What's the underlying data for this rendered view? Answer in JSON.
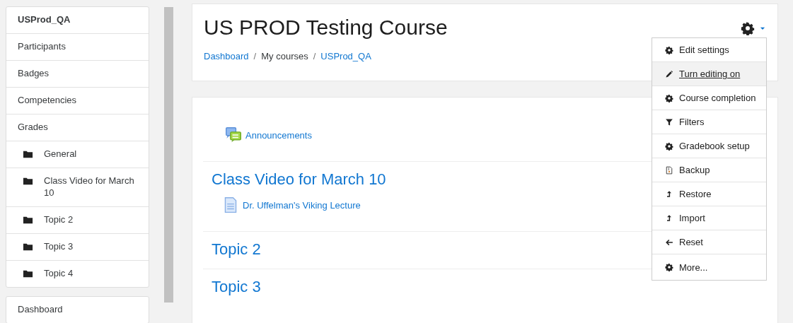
{
  "sidebar": {
    "course_block": [
      {
        "label": "USProd_QA",
        "kind": "heading"
      },
      {
        "label": "Participants",
        "kind": "link"
      },
      {
        "label": "Badges",
        "kind": "link"
      },
      {
        "label": "Competencies",
        "kind": "link"
      },
      {
        "label": "Grades",
        "kind": "link",
        "children": [
          {
            "label": "General",
            "kind": "folder"
          },
          {
            "label": "Class Video for March 10",
            "kind": "folder"
          },
          {
            "label": "Topic 2",
            "kind": "folder"
          },
          {
            "label": "Topic 3",
            "kind": "folder"
          },
          {
            "label": "Topic 4",
            "kind": "folder"
          }
        ]
      }
    ],
    "site_block": [
      {
        "label": "Dashboard",
        "kind": "link"
      }
    ]
  },
  "header": {
    "title": "US PROD Testing Course",
    "breadcrumb": [
      {
        "label": "Dashboard",
        "kind": "link"
      },
      {
        "label": "/",
        "kind": "separator"
      },
      {
        "label": "My courses",
        "kind": "text"
      },
      {
        "label": "/",
        "kind": "separator"
      },
      {
        "label": "USProd_QA",
        "kind": "link"
      }
    ]
  },
  "settings_menu": {
    "expanded": true,
    "items": [
      {
        "label": "Edit settings",
        "kind": "gear",
        "highlighted": false
      },
      {
        "label": "Turn editing on",
        "kind": "pencil",
        "highlighted": true
      },
      {
        "label": "Course completion",
        "kind": "gear",
        "highlighted": false
      },
      {
        "label": "Filters",
        "kind": "filter",
        "highlighted": false
      },
      {
        "label": "Gradebook setup",
        "kind": "gear",
        "highlighted": false
      },
      {
        "label": "Backup",
        "kind": "file",
        "highlighted": false
      },
      {
        "label": "Restore",
        "kind": "upload",
        "highlighted": false
      },
      {
        "label": "Import",
        "kind": "upload",
        "highlighted": false
      },
      {
        "label": "Reset",
        "kind": "back",
        "highlighted": false
      },
      {
        "label": "More...",
        "kind": "gear",
        "highlighted": false
      }
    ]
  },
  "sections": [
    {
      "activities": [
        {
          "label": "Announcements",
          "kind": "forum"
        }
      ]
    },
    {
      "title": "Class Video for March 10",
      "activities": [
        {
          "label": "Dr. Uffelman's Viking Lecture",
          "kind": "page"
        }
      ]
    },
    {
      "title": "Topic 2"
    },
    {
      "title": "Topic 3"
    }
  ]
}
